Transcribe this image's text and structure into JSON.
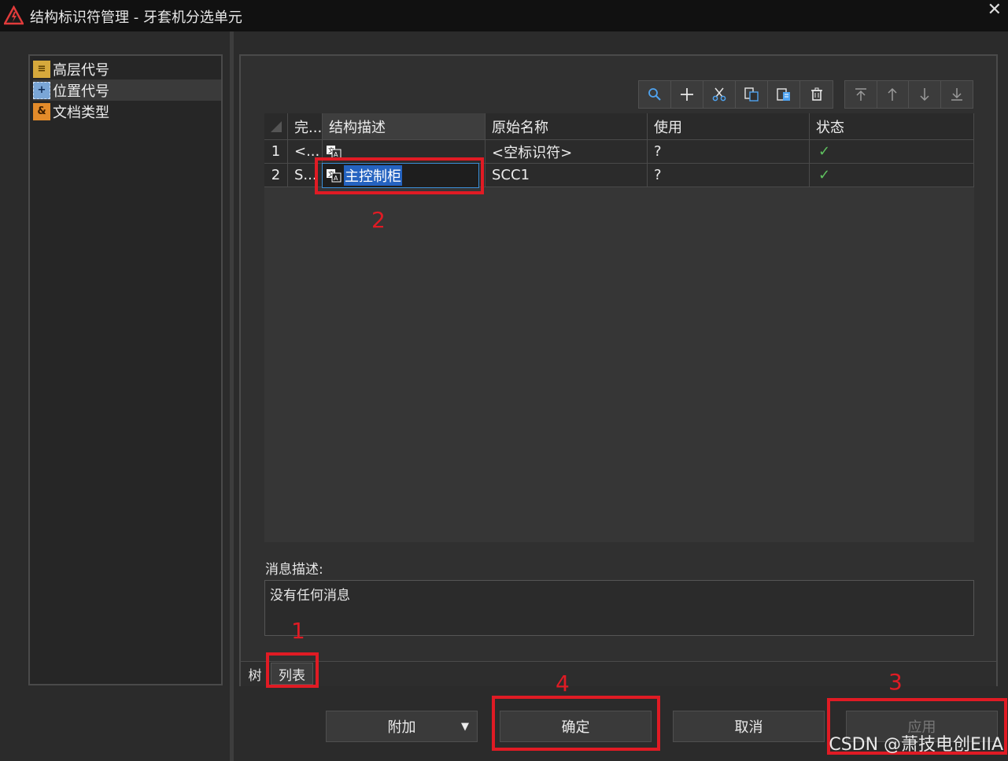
{
  "window": {
    "title": "结构标识符管理 - 牙套机分选单元",
    "close_glyph": "✕"
  },
  "tree": {
    "items": [
      {
        "label": "高层代号",
        "icon": "higher-level-icon",
        "icon_glyph": "≡",
        "icon_color": "#d6a93c"
      },
      {
        "label": "位置代号",
        "icon": "location-icon",
        "icon_glyph": "+",
        "icon_color": "#7aa6d6"
      },
      {
        "label": "文档类型",
        "icon": "document-type-icon",
        "icon_glyph": "&",
        "icon_color": "#e38b2a"
      }
    ],
    "selected_index": 1
  },
  "toolbar": {
    "buttons": [
      "search-icon",
      "add-icon",
      "cut-icon",
      "copy-icon",
      "paste-icon",
      "delete-icon"
    ],
    "move_buttons": [
      "move-top-icon",
      "move-up-icon",
      "move-down-icon",
      "move-bottom-icon"
    ]
  },
  "grid": {
    "columns": [
      "完...",
      "结构描述",
      "原始名称",
      "使用",
      "状态"
    ],
    "rows": [
      {
        "num": "1",
        "complete": "<...",
        "description": "",
        "original_name": "<空标识符>",
        "usage": "?",
        "status": "✓"
      },
      {
        "num": "2",
        "complete": "S...",
        "description": "主控制柜",
        "original_name": "SCC1",
        "usage": "?",
        "status": "✓"
      }
    ]
  },
  "message": {
    "label": "消息描述:",
    "text": "没有任何消息"
  },
  "tabs": [
    "树",
    "列表"
  ],
  "buttons": {
    "attach": "附加",
    "dropdown_glyph": "▼",
    "ok": "确定",
    "cancel": "取消",
    "apply": "应用"
  },
  "annotations": [
    "1",
    "2",
    "3",
    "4"
  ],
  "watermark": "CSDN @萧技电创EIIA",
  "colors": {
    "annotation_red": "#e01b24",
    "selection_blue": "#2563c0",
    "check_green": "#5fc25f"
  }
}
